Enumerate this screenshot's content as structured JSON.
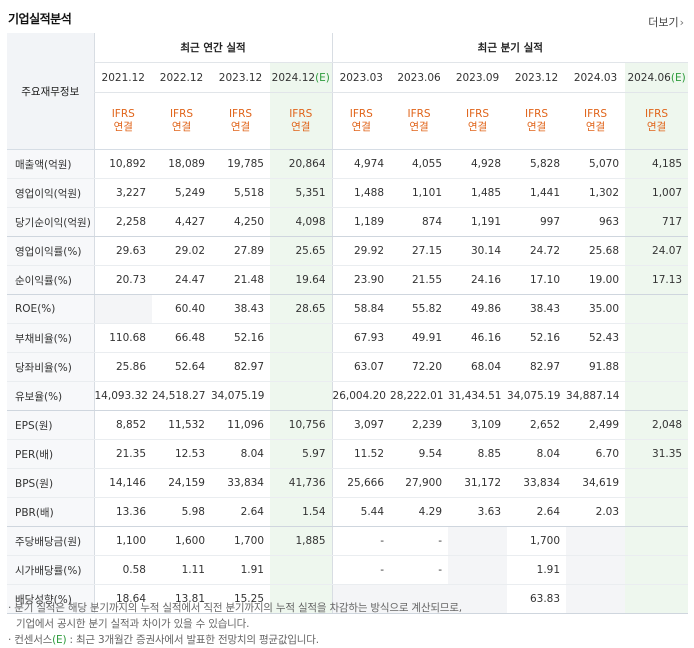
{
  "section_title": "기업실적분석",
  "more_link": "더보기",
  "header": {
    "row_label": "주요재무정보",
    "annual_group": "최근 연간 실적",
    "quarter_group": "최근 분기 실적",
    "periods": [
      "2021.12",
      "2022.12",
      "2023.12",
      "2024.12",
      "2023.03",
      "2023.06",
      "2023.09",
      "2023.12",
      "2024.03",
      "2024.06"
    ],
    "estimate_mark": "(E)",
    "ifrs": "IFRS",
    "consolidated": "연결"
  },
  "rows": [
    {
      "name": "매출액(억원)",
      "values": [
        "10,892",
        "18,089",
        "19,785",
        "20,864",
        "4,974",
        "4,055",
        "4,928",
        "5,828",
        "5,070",
        "4,185"
      ]
    },
    {
      "name": "영업이익(억원)",
      "values": [
        "3,227",
        "5,249",
        "5,518",
        "5,351",
        "1,488",
        "1,101",
        "1,485",
        "1,441",
        "1,302",
        "1,007"
      ]
    },
    {
      "name": "당기순이익(억원)",
      "values": [
        "2,258",
        "4,427",
        "4,250",
        "4,098",
        "1,189",
        "874",
        "1,191",
        "997",
        "963",
        "717"
      ]
    },
    {
      "name": "영업이익률(%)",
      "values": [
        "29.63",
        "29.02",
        "27.89",
        "25.65",
        "29.92",
        "27.15",
        "30.14",
        "24.72",
        "25.68",
        "24.07"
      ]
    },
    {
      "name": "순이익률(%)",
      "values": [
        "20.73",
        "24.47",
        "21.48",
        "19.64",
        "23.90",
        "21.55",
        "24.16",
        "17.10",
        "19.00",
        "17.13"
      ]
    },
    {
      "name": "ROE(%)",
      "values": [
        "",
        "60.40",
        "38.43",
        "28.65",
        "58.84",
        "55.82",
        "49.86",
        "38.43",
        "35.00",
        ""
      ]
    },
    {
      "name": "부채비율(%)",
      "values": [
        "110.68",
        "66.48",
        "52.16",
        "",
        "67.93",
        "49.91",
        "46.16",
        "52.16",
        "52.43",
        ""
      ]
    },
    {
      "name": "당좌비율(%)",
      "values": [
        "25.86",
        "52.64",
        "82.97",
        "",
        "63.07",
        "72.20",
        "68.04",
        "82.97",
        "91.88",
        ""
      ]
    },
    {
      "name": "유보율(%)",
      "values": [
        "14,093.32",
        "24,518.27",
        "34,075.19",
        "",
        "26,004.20",
        "28,222.01",
        "31,434.51",
        "34,075.19",
        "34,887.14",
        ""
      ]
    },
    {
      "name": "EPS(원)",
      "values": [
        "8,852",
        "11,532",
        "11,096",
        "10,756",
        "3,097",
        "2,239",
        "3,109",
        "2,652",
        "2,499",
        "2,048"
      ]
    },
    {
      "name": "PER(배)",
      "values": [
        "21.35",
        "12.53",
        "8.04",
        "5.97",
        "11.52",
        "9.54",
        "8.85",
        "8.04",
        "6.70",
        "31.35"
      ]
    },
    {
      "name": "BPS(원)",
      "values": [
        "14,146",
        "24,159",
        "33,834",
        "41,736",
        "25,666",
        "27,900",
        "31,172",
        "33,834",
        "34,619",
        ""
      ]
    },
    {
      "name": "PBR(배)",
      "values": [
        "13.36",
        "5.98",
        "2.64",
        "1.54",
        "5.44",
        "4.29",
        "3.63",
        "2.64",
        "2.03",
        ""
      ]
    },
    {
      "name": "주당배당금(원)",
      "values": [
        "1,100",
        "1,600",
        "1,700",
        "1,885",
        "-",
        "-",
        "",
        "1,700",
        "",
        ""
      ]
    },
    {
      "name": "시가배당률(%)",
      "values": [
        "0.58",
        "1.11",
        "1.91",
        "",
        "-",
        "-",
        "",
        "1.91",
        "",
        ""
      ]
    },
    {
      "name": "배당성향(%)",
      "values": [
        "18.64",
        "13.81",
        "15.25",
        "",
        "",
        "",
        "",
        "63.83",
        "",
        ""
      ]
    }
  ],
  "notes": {
    "line1": "분기 실적은 해당 분기까지의 누적 실적에서 직전 분기까지의 누적 실적을 차감하는 방식으로 계산되므로,",
    "line2": "기업에서 공시한 분기 실적과 차이가 있을 수 있습니다.",
    "line3_prefix": "컨센서스",
    "line3_mark": "(E)",
    "line3_suffix": ": 최근 3개월간 증권사에서 발표한 전망치의 평균값입니다."
  }
}
